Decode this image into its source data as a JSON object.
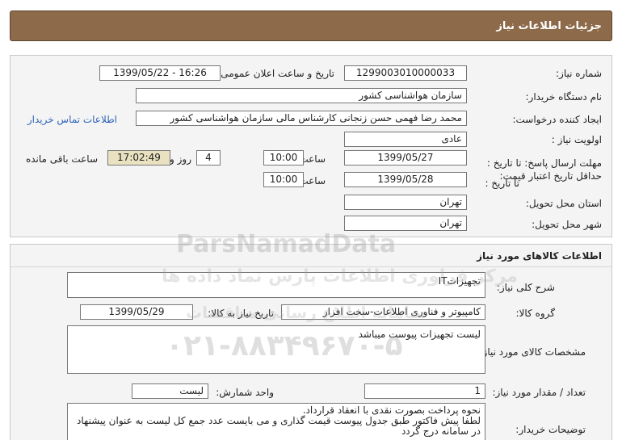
{
  "page_header": "جزئیات اطلاعات نیاز",
  "need_info": {
    "need_number_label": "شماره نیاز:",
    "need_number": "1299003010000033",
    "announce_label": "تاریخ و ساعت اعلان عمومی:",
    "announce_value": "1399/05/22 - 16:26",
    "buyer_org_label": "نام دستگاه خریدار:",
    "buyer_org": "سازمان هواشناسی کشور",
    "requester_label": "ایجاد کننده درخواست:",
    "requester": "محمد رضا فهمی حسن زنجانی کارشناس مالی سازمان هواشناسی کشور",
    "contact_link": "اطلاعات تماس خریدار",
    "priority_label": "اولویت نیاز :",
    "priority": "عادی",
    "deadline_label": "مهلت ارسال پاسخ: تا تاریخ :",
    "deadline_date": "1399/05/27",
    "time_label": "ساعت",
    "deadline_time": "10:00",
    "days_count": "4",
    "days_label": "روز و",
    "remaining_time": "17:02:49",
    "remaining_label": "ساعت باقی مانده",
    "validity_label": "حداقل تاریخ اعتبار قیمت:",
    "validity_to_label": "تا تاریخ :",
    "validity_date": "1399/05/28",
    "validity_time_label": "ساعت",
    "validity_time": "10:00",
    "province_label": "استان محل تحویل:",
    "province": "تهران",
    "city_label": "شهر محل تحویل:",
    "city": "تهران"
  },
  "goods": {
    "section_title": "اطلاعات کالاهای مورد نیاز",
    "description_label": "شرح کلی نیاز:",
    "description": "تجهیزاتIT",
    "group_label": "گروه کالا:",
    "group": "کامپیوتر و فناوری اطلاعات-سخت افزار",
    "need_date_label": "تاریخ نیاز به کالا:",
    "need_date": "1399/05/29",
    "specs_label": "مشخصات کالای مورد نیاز:",
    "specs": "لیست تجهیزات پیوست میباشد",
    "quantity_label": "تعداد / مقدار مورد نیاز:",
    "quantity": "1",
    "unit_label": "واحد شمارش:",
    "unit": "لیست",
    "buyer_notes_label": "توضیحات خریدار:",
    "buyer_notes": [
      "نحوه پرداخت بصورت نقدی با انعقاد قرارداد.",
      "لطفا پیش فاکتور طبق جدول پیوست قیمت گذاری و می بایست عدد جمع کل لیست به عنوان پیشنهاد",
      "در سامانه درج گردد"
    ]
  },
  "watermark": {
    "brand": "ParsNamadData",
    "tagline": "مرکز فراوری اطلاعات پارس نماد داده ها",
    "subtitle": "سامانه اطلاع رسانی مناقصات",
    "phone": "۰۲۱-۸۸۳۴۹۶۷۰-۵"
  }
}
